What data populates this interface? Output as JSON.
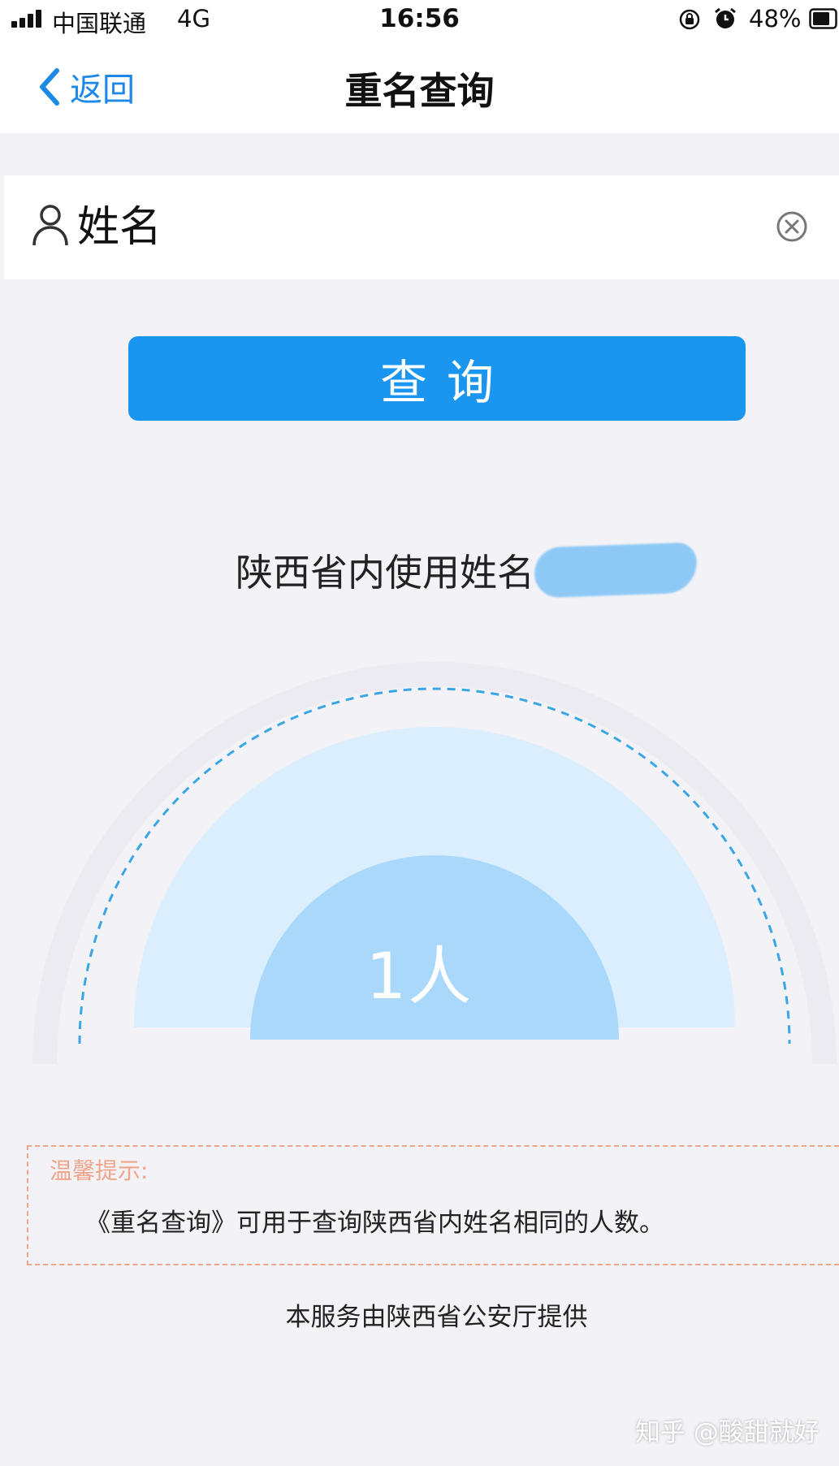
{
  "status_bar": {
    "carrier": "中国联通",
    "network": "4G",
    "time": "16:56",
    "battery": "48%",
    "icons": [
      "signal-icon",
      "orientation-lock-icon",
      "alarm-icon",
      "battery-icon"
    ]
  },
  "nav": {
    "back_label": "返回",
    "title": "重名查询"
  },
  "search": {
    "placeholder": "姓名",
    "value": ""
  },
  "query_button": {
    "label": "查询"
  },
  "result": {
    "text": "陕西省内使用姓名",
    "count_label": "1人"
  },
  "tips": {
    "title": "温馨提示:",
    "body": "《重名查询》可用于查询陕西省内姓名相同的人数。"
  },
  "footer": {
    "provider": "本服务由陕西省公安厅提供"
  },
  "watermark": "知乎 @酸甜就好",
  "colors": {
    "accent": "#1a95f0",
    "back_link": "#1e88e5",
    "tip_border": "#f0a58a",
    "gauge_inner": "#a9d8fb",
    "gauge_middle": "#daeefd",
    "gauge_dash": "#3aa6e6"
  }
}
